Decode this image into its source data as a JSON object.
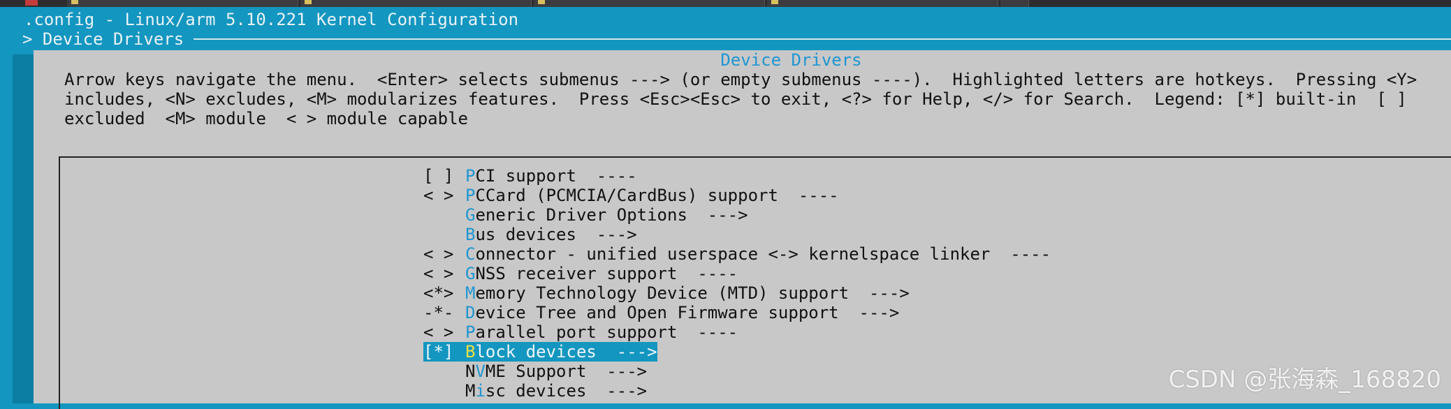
{
  "window": {
    "title": ".config - Linux/arm 5.10.221 Kernel Configuration",
    "breadcrumb": "> Device Drivers"
  },
  "dialog": {
    "title": "Device Drivers",
    "help_lines": [
      "Arrow keys navigate the menu.  <Enter> selects submenus ---> (or empty submenus ----).  Highlighted letters are hotkeys.  Pressing <Y>",
      "includes, <N> excludes, <M> modularizes features.  Press <Esc><Esc> to exit, <?> for Help, </> for Search.  Legend: [*] built-in  [ ]",
      "excluded  <M> module  < > module capable"
    ]
  },
  "menu": {
    "items": [
      {
        "prefix": "[ ]",
        "hotkey": "P",
        "rest": "CI support  ----",
        "selected": false
      },
      {
        "prefix": "< >",
        "hotkey": "P",
        "rest": "CCard (PCMCIA/CardBus) support  ----",
        "selected": false
      },
      {
        "prefix": "",
        "hotkey": "G",
        "rest": "eneric Driver Options  --->",
        "selected": false
      },
      {
        "prefix": "",
        "hotkey": "B",
        "rest": "us devices  --->",
        "selected": false
      },
      {
        "prefix": "< >",
        "hotkey": "C",
        "rest": "onnector - unified userspace <-> kernelspace linker  ----",
        "selected": false
      },
      {
        "prefix": "< >",
        "hotkey": "G",
        "rest": "NSS receiver support  ----",
        "selected": false
      },
      {
        "prefix": "<*>",
        "hotkey": "M",
        "pre": "",
        "rest": "emory Technology Device (MTD) support  --->",
        "selected": false
      },
      {
        "prefix": "-*-",
        "hotkey": "D",
        "rest": "evice Tree and Open Firmware support  --->",
        "selected": false
      },
      {
        "prefix": "< >",
        "hotkey": "P",
        "rest": "arallel port support  ----",
        "selected": false
      },
      {
        "prefix": "[*]",
        "hotkey": "B",
        "rest": "lock devices  --->",
        "selected": true
      },
      {
        "prefix": "",
        "lead": "N",
        "hotkey": "V",
        "rest": "ME Support  --->",
        "selected": false
      },
      {
        "prefix": "",
        "lead": "M",
        "hotkey": "i",
        "rest": "sc devices  --->",
        "selected": false
      }
    ]
  },
  "watermark": "CSDN @张海森_168820",
  "colors": {
    "background": "#1396c0",
    "dialog": "#c8c8c8",
    "hotkey": "#1e96d2",
    "selected_hotkey": "#f0e040"
  }
}
